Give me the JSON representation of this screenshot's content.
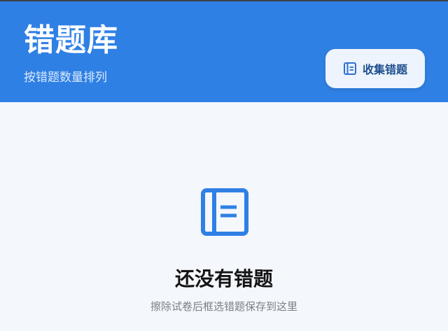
{
  "header": {
    "title": "错题库",
    "subtitle": "按错题数量排列",
    "collect_button": {
      "label": "收集错题",
      "icon": "notebook-icon"
    }
  },
  "empty_state": {
    "icon": "notebook-icon",
    "title": "还没有错题",
    "description": "擦除试卷后框选错题保存到这里"
  },
  "colors": {
    "header_bg": "#2f80e5",
    "accent": "#2f80e5",
    "page_bg": "#f4f7fc"
  }
}
